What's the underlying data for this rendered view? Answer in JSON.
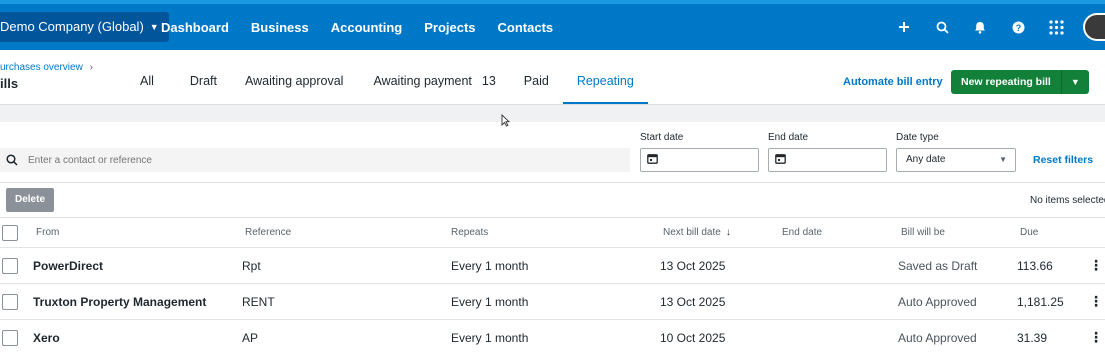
{
  "topbar": {
    "org_name": "Demo Company (Global)",
    "nav": [
      "Dashboard",
      "Business",
      "Accounting",
      "Projects",
      "Contacts"
    ],
    "icons": [
      "plus-icon",
      "search-icon",
      "bell-icon",
      "help-icon",
      "apps-grid-icon"
    ]
  },
  "header": {
    "breadcrumb": "urchases overview",
    "breadcrumb_sep": "›",
    "title": "ills",
    "tabs": [
      {
        "label": "All",
        "count": ""
      },
      {
        "label": "Draft",
        "count": ""
      },
      {
        "label": "Awaiting approval",
        "count": ""
      },
      {
        "label": "Awaiting payment",
        "count": "13"
      },
      {
        "label": "Paid",
        "count": ""
      },
      {
        "label": "Repeating",
        "count": ""
      }
    ],
    "active_tab": "Repeating",
    "automate_label": "Automate bill entry",
    "new_repeating_label": "New repeating bill"
  },
  "filters": {
    "search_placeholder": "Enter a contact or reference",
    "start_date_label": "Start date",
    "end_date_label": "End date",
    "date_type_label": "Date type",
    "date_type_value": "Any date",
    "reset_label": "Reset filters"
  },
  "actions": {
    "delete_label": "Delete",
    "selection_status": "No items selected"
  },
  "table": {
    "headers": {
      "from": "From",
      "reference": "Reference",
      "repeats": "Repeats",
      "next_bill_date": "Next bill date",
      "end_date": "End date",
      "bill_will_be": "Bill will be",
      "due": "Due"
    },
    "rows": [
      {
        "from": "PowerDirect",
        "reference": "Rpt",
        "repeats": "Every 1 month",
        "next_bill_date": "13 Oct 2025",
        "end_date": "",
        "bill_will_be": "Saved as Draft",
        "due": "113.66"
      },
      {
        "from": "Truxton Property Management",
        "reference": "RENT",
        "repeats": "Every 1 month",
        "next_bill_date": "13 Oct 2025",
        "end_date": "",
        "bill_will_be": "Auto Approved",
        "due": "1,181.25"
      },
      {
        "from": "Xero",
        "reference": "AP",
        "repeats": "Every 1 month",
        "next_bill_date": "10 Oct 2025",
        "end_date": "",
        "bill_will_be": "Auto Approved",
        "due": "31.39"
      }
    ]
  },
  "colors": {
    "nav_blue": "#0078c8",
    "org_chip": "#00559b",
    "primary_green": "#13803a",
    "link_blue": "#0078c8"
  }
}
